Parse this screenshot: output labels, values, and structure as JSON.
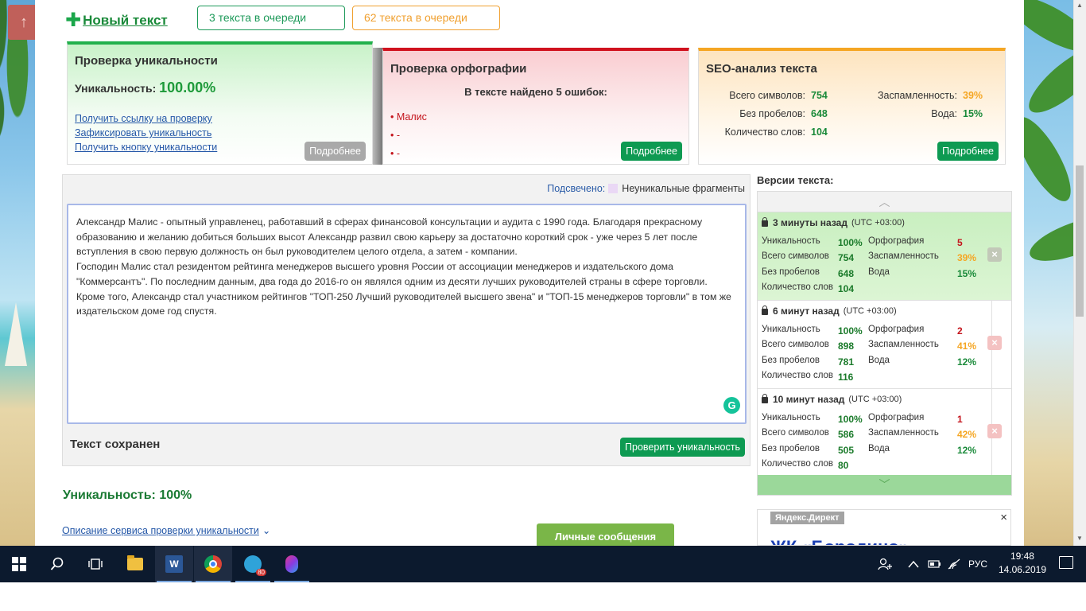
{
  "top": {
    "new_text": "Новый текст",
    "queue_green": "3 текста в очереди",
    "queue_orange": "62 текста в очереди"
  },
  "uniqueness_panel": {
    "title": "Проверка уникальности",
    "label": "Уникальность:",
    "value": "100.00%",
    "links": [
      "Получить ссылку на проверку",
      "Зафиксировать уникальность",
      "Получить кнопку уникальности"
    ],
    "more": "Подробнее"
  },
  "spelling_panel": {
    "title": "Проверка орфографии",
    "summary": "В тексте найдено 5 ошибок:",
    "errors": [
      "Малис",
      "-",
      "-"
    ],
    "more": "Подробнее"
  },
  "seo_panel": {
    "title": "SEO-анализ текста",
    "left": [
      {
        "label": "Всего символов:",
        "value": "754"
      },
      {
        "label": "Без пробелов:",
        "value": "648"
      },
      {
        "label": "Количество слов:",
        "value": "104"
      }
    ],
    "right": [
      {
        "label": "Заспамленность:",
        "value": "39%",
        "color": "#f5a623"
      },
      {
        "label": "Вода:",
        "value": "15%",
        "color": "#1a8a3a"
      }
    ],
    "more": "Подробнее"
  },
  "editor": {
    "highlight_label": "Подсвечено:",
    "highlight_legend": "Неуникальные фрагменты",
    "paragraphs": [
      "Александр Малис - опытный управленец, работавший в сферах финансовой консультации и аудита с 1990 года. Благодаря прекрасному образованию и желанию добиться больших высот Александр развил свою карьеру за достаточно короткий срок - уже через 5 лет после вступления в свою первую должность он был руководителем целого отдела, а затем - компании.",
      "Господин Малис стал резидентом рейтинга менеджеров высшего уровня России от ассоциации менеджеров и издательского дома \"Коммерсантъ\". По последним данным, два года до 2016-го он являлся одним из десяти лучших руководителей страны в сфере торговли. Кроме того, Александр стал участником рейтингов \"ТОП-250 Лучший руководителей высшего звена\" и \"ТОП-15 менеджеров торговли\" в том же издательском доме год спустя."
    ],
    "saved": "Текст сохранен",
    "check_button": "Проверить уникальность",
    "grammarly": "G"
  },
  "result": {
    "uniqueness": "Уникальность: 100%",
    "description_link": "Описание сервиса проверки уникальности",
    "messages_button": "Личные сообщения"
  },
  "versions": {
    "title": "Версии текста:",
    "labels": {
      "uniq": "Уникальность",
      "total": "Всего символов",
      "nospace": "Без пробелов",
      "words": "Количество слов",
      "spelling": "Орфография",
      "spam": "Заспамленность",
      "water": "Вода"
    },
    "items": [
      {
        "time": "3 минуты назад",
        "tz": "(UTC +03:00)",
        "uniq": "100%",
        "total": "754",
        "nospace": "648",
        "words": "104",
        "spelling": "5",
        "spam": "39%",
        "water": "15%"
      },
      {
        "time": "6 минут назад",
        "tz": "(UTC +03:00)",
        "uniq": "100%",
        "total": "898",
        "nospace": "781",
        "words": "116",
        "spelling": "2",
        "spam": "41%",
        "water": "12%"
      },
      {
        "time": "10 минут назад",
        "tz": "(UTC +03:00)",
        "uniq": "100%",
        "total": "586",
        "nospace": "505",
        "words": "80",
        "spelling": "1",
        "spam": "42%",
        "water": "12%"
      }
    ],
    "colors": {
      "spelling": "#c4141c",
      "spam": "#f5a623",
      "water": "#1a8a3a"
    }
  },
  "ad": {
    "tag": "Яндекс.Директ",
    "title": "ЖК «Бородино»",
    "close": "×"
  },
  "taskbar": {
    "telegram_badge": "80",
    "word_letter": "W",
    "lang": "РУС",
    "time": "19:48",
    "date": "14.06.2019"
  }
}
